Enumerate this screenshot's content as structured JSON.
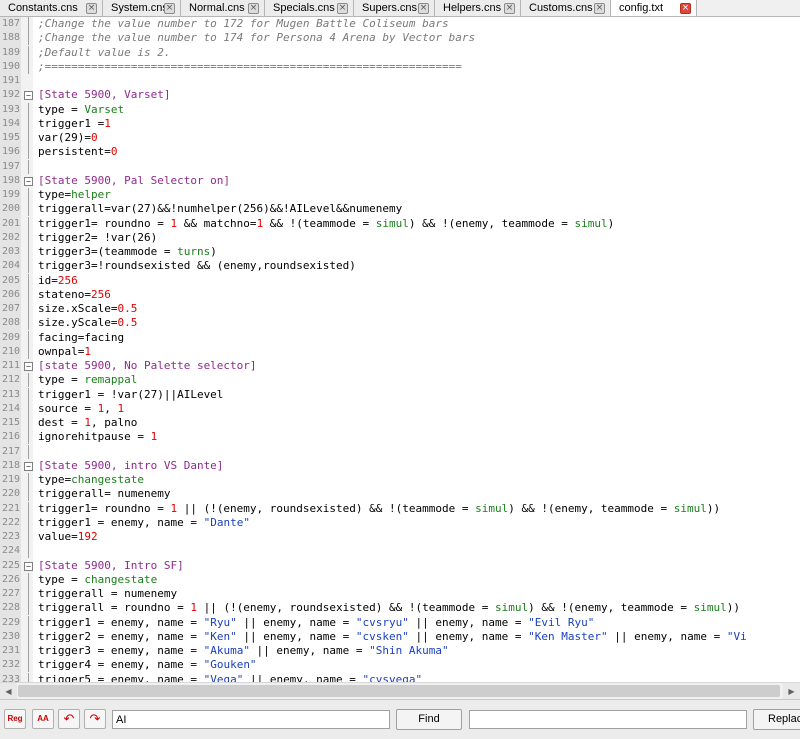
{
  "tabs": [
    {
      "label": "Constants.cns",
      "active": false
    },
    {
      "label": "System.cns",
      "active": false
    },
    {
      "label": "Normal.cns",
      "active": false
    },
    {
      "label": "Specials.cns",
      "active": false
    },
    {
      "label": "Supers.cns",
      "active": false
    },
    {
      "label": "Helpers.cns",
      "active": false
    },
    {
      "label": "Customs.cns",
      "active": false
    },
    {
      "label": "config.txt",
      "active": true
    }
  ],
  "colors": {
    "comment": "#7a7a7a",
    "section": "#8e2a8e",
    "keyword": "#1a7f1a",
    "number": "#e00000",
    "string": "#1a3fbf",
    "active_tab_close": "#e0463a"
  },
  "icons": {
    "tab_close": "close-icon",
    "fold_open": "fold-minus-icon",
    "prev": "undo-arrow-icon",
    "next": "redo-arrow-icon"
  },
  "editor": {
    "lines": [
      {
        "n": "187",
        "fold": "line",
        "tokens": [
          [
            "c",
            ";Change the value number to 172 for Mugen Battle Coliseum bars"
          ]
        ]
      },
      {
        "n": "188",
        "fold": "line",
        "tokens": [
          [
            "c",
            ";Change the value number to 174 for Persona 4 Arena by Vector bars"
          ]
        ]
      },
      {
        "n": "189",
        "fold": "line",
        "tokens": [
          [
            "c",
            ";Default value is 2."
          ]
        ]
      },
      {
        "n": "190",
        "fold": "line",
        "tokens": [
          [
            "c",
            ";==============================================================="
          ]
        ]
      },
      {
        "n": "191",
        "fold": "",
        "tokens": []
      },
      {
        "n": "192",
        "fold": "box",
        "tokens": [
          [
            "s",
            "[State 5900, Varset]"
          ]
        ]
      },
      {
        "n": "193",
        "fold": "line",
        "tokens": [
          [
            "p",
            "type = "
          ],
          [
            "k",
            "Varset"
          ]
        ]
      },
      {
        "n": "194",
        "fold": "line",
        "tokens": [
          [
            "p",
            "trigger1 ="
          ],
          [
            "n",
            "1"
          ]
        ]
      },
      {
        "n": "195",
        "fold": "line",
        "tokens": [
          [
            "p",
            "var(29)="
          ],
          [
            "n",
            "0"
          ]
        ]
      },
      {
        "n": "196",
        "fold": "line",
        "tokens": [
          [
            "p",
            "persistent="
          ],
          [
            "n",
            "0"
          ]
        ]
      },
      {
        "n": "197",
        "fold": "line",
        "tokens": []
      },
      {
        "n": "198",
        "fold": "box",
        "tokens": [
          [
            "s",
            "[State 5900, Pal Selector on]"
          ]
        ]
      },
      {
        "n": "199",
        "fold": "line",
        "tokens": [
          [
            "p",
            "type="
          ],
          [
            "k",
            "helper"
          ]
        ]
      },
      {
        "n": "200",
        "fold": "line",
        "tokens": [
          [
            "p",
            "triggerall=var(27)&&!numhelper(256)&&!AILevel&&numenemy"
          ]
        ]
      },
      {
        "n": "201",
        "fold": "line",
        "tokens": [
          [
            "p",
            "trigger1= roundno = "
          ],
          [
            "n",
            "1"
          ],
          [
            "p",
            " && matchno="
          ],
          [
            "n",
            "1"
          ],
          [
            "p",
            " && !(teammode = "
          ],
          [
            "k",
            "simul"
          ],
          [
            "p",
            ") && !(enemy, teammode = "
          ],
          [
            "k",
            "simul"
          ],
          [
            "p",
            ")"
          ]
        ]
      },
      {
        "n": "202",
        "fold": "line",
        "tokens": [
          [
            "p",
            "trigger2= !var(26)"
          ]
        ]
      },
      {
        "n": "203",
        "fold": "line",
        "tokens": [
          [
            "p",
            "trigger3=(teammode = "
          ],
          [
            "k",
            "turns"
          ],
          [
            "p",
            ")"
          ]
        ]
      },
      {
        "n": "204",
        "fold": "line",
        "tokens": [
          [
            "p",
            "trigger3=!roundsexisted && (enemy,roundsexisted)"
          ]
        ]
      },
      {
        "n": "205",
        "fold": "line",
        "tokens": [
          [
            "p",
            "id="
          ],
          [
            "n",
            "256"
          ]
        ]
      },
      {
        "n": "206",
        "fold": "line",
        "tokens": [
          [
            "p",
            "stateno="
          ],
          [
            "n",
            "256"
          ]
        ]
      },
      {
        "n": "207",
        "fold": "line",
        "tokens": [
          [
            "p",
            "size.xScale="
          ],
          [
            "n",
            "0.5"
          ]
        ]
      },
      {
        "n": "208",
        "fold": "line",
        "tokens": [
          [
            "p",
            "size.yScale="
          ],
          [
            "n",
            "0.5"
          ]
        ]
      },
      {
        "n": "209",
        "fold": "line",
        "tokens": [
          [
            "p",
            "facing=facing"
          ]
        ]
      },
      {
        "n": "210",
        "fold": "line",
        "tokens": [
          [
            "p",
            "ownpal="
          ],
          [
            "n",
            "1"
          ]
        ]
      },
      {
        "n": "211",
        "fold": "box",
        "tokens": [
          [
            "s",
            "[state 5900, No Palette selector]"
          ]
        ]
      },
      {
        "n": "212",
        "fold": "line",
        "tokens": [
          [
            "p",
            "type = "
          ],
          [
            "k",
            "remappal"
          ]
        ]
      },
      {
        "n": "213",
        "fold": "line",
        "tokens": [
          [
            "p",
            "trigger1 = !var(27)||AILevel"
          ]
        ]
      },
      {
        "n": "214",
        "fold": "line",
        "tokens": [
          [
            "p",
            "source = "
          ],
          [
            "n",
            "1"
          ],
          [
            "p",
            ", "
          ],
          [
            "n",
            "1"
          ]
        ]
      },
      {
        "n": "215",
        "fold": "line",
        "tokens": [
          [
            "p",
            "dest = "
          ],
          [
            "n",
            "1"
          ],
          [
            "p",
            ", palno"
          ]
        ]
      },
      {
        "n": "216",
        "fold": "line",
        "tokens": [
          [
            "p",
            "ignorehitpause = "
          ],
          [
            "n",
            "1"
          ]
        ]
      },
      {
        "n": "217",
        "fold": "line",
        "tokens": []
      },
      {
        "n": "218",
        "fold": "box",
        "tokens": [
          [
            "s",
            "[State 5900, intro VS Dante]"
          ]
        ]
      },
      {
        "n": "219",
        "fold": "line",
        "tokens": [
          [
            "p",
            "type="
          ],
          [
            "k",
            "changestate"
          ]
        ]
      },
      {
        "n": "220",
        "fold": "line",
        "tokens": [
          [
            "p",
            "triggerall= numenemy"
          ]
        ]
      },
      {
        "n": "221",
        "fold": "line",
        "tokens": [
          [
            "p",
            "trigger1= roundno = "
          ],
          [
            "n",
            "1"
          ],
          [
            "p",
            " || (!(enemy, roundsexisted) && !(teammode = "
          ],
          [
            "k",
            "simul"
          ],
          [
            "p",
            ") && !(enemy, teammode = "
          ],
          [
            "k",
            "simul"
          ],
          [
            "p",
            "))"
          ]
        ]
      },
      {
        "n": "222",
        "fold": "line",
        "tokens": [
          [
            "p",
            "trigger1 = enemy, name = "
          ],
          [
            "t",
            "\"Dante\""
          ]
        ]
      },
      {
        "n": "223",
        "fold": "line",
        "tokens": [
          [
            "p",
            "value="
          ],
          [
            "n",
            "192"
          ]
        ]
      },
      {
        "n": "224",
        "fold": "line",
        "tokens": []
      },
      {
        "n": "225",
        "fold": "box",
        "tokens": [
          [
            "s",
            "[State 5900, Intro SF]"
          ]
        ]
      },
      {
        "n": "226",
        "fold": "line",
        "tokens": [
          [
            "p",
            "type = "
          ],
          [
            "k",
            "changestate"
          ]
        ]
      },
      {
        "n": "227",
        "fold": "line",
        "tokens": [
          [
            "p",
            "triggerall = numenemy"
          ]
        ]
      },
      {
        "n": "228",
        "fold": "line",
        "tokens": [
          [
            "p",
            "triggerall = roundno = "
          ],
          [
            "n",
            "1"
          ],
          [
            "p",
            " || (!(enemy, roundsexisted) && !(teammode = "
          ],
          [
            "k",
            "simul"
          ],
          [
            "p",
            ") && !(enemy, teammode = "
          ],
          [
            "k",
            "simul"
          ],
          [
            "p",
            "))"
          ]
        ]
      },
      {
        "n": "229",
        "fold": "line",
        "tokens": [
          [
            "p",
            "trigger1 = enemy, name = "
          ],
          [
            "t",
            "\"Ryu\""
          ],
          [
            "p",
            " || enemy, name = "
          ],
          [
            "t",
            "\"cvsryu\""
          ],
          [
            "p",
            " || enemy, name = "
          ],
          [
            "t",
            "\"Evil Ryu\""
          ]
        ]
      },
      {
        "n": "230",
        "fold": "line",
        "tokens": [
          [
            "p",
            "trigger2 = enemy, name = "
          ],
          [
            "t",
            "\"Ken\""
          ],
          [
            "p",
            " || enemy, name = "
          ],
          [
            "t",
            "\"cvsken\""
          ],
          [
            "p",
            " || enemy, name = "
          ],
          [
            "t",
            "\"Ken Master\""
          ],
          [
            "p",
            " || enemy, name = "
          ],
          [
            "t",
            "\"Vi"
          ]
        ]
      },
      {
        "n": "231",
        "fold": "line",
        "tokens": [
          [
            "p",
            "trigger3 = enemy, name = "
          ],
          [
            "t",
            "\"Akuma\""
          ],
          [
            "p",
            " || enemy, name = "
          ],
          [
            "t",
            "\"Shin Akuma\""
          ]
        ]
      },
      {
        "n": "232",
        "fold": "line",
        "tokens": [
          [
            "p",
            "trigger4 = enemy, name = "
          ],
          [
            "t",
            "\"Gouken\""
          ]
        ]
      },
      {
        "n": "233",
        "fold": "line",
        "tokens": [
          [
            "p",
            "trigger5 = enemy, name = "
          ],
          [
            "t",
            "\"Vega\""
          ],
          [
            "p",
            " || enemy, name = "
          ],
          [
            "t",
            "\"cvsvega\""
          ]
        ]
      }
    ]
  },
  "findbar": {
    "reg_label": "Reg",
    "case_label": "AA",
    "find_value": "AI",
    "find_label": "Find",
    "replace_value": "",
    "replace_label": "Replace"
  }
}
